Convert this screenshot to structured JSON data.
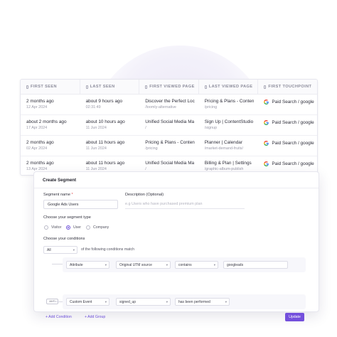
{
  "table": {
    "columns": [
      "FIRST SEEN",
      "LAST SEEN",
      "FIRST VIEWED PAGE",
      "LAST VIEWED PAGE",
      "FIRST TOUCHPOINT"
    ],
    "rows": [
      {
        "first_seen": "2 months ago",
        "first_seen_date": "12 Apr 2024",
        "last_seen": "about 9 hours ago",
        "last_seen_date": "02:31:49",
        "first_page_title": "Discover the Perfect Loc",
        "first_page_path": "/loomly-alternative",
        "last_page_title": "Pricing & Plans - Conten",
        "last_page_path": "/pricing",
        "touchpoint": "Paid Search / google"
      },
      {
        "first_seen": "about 2 months ago",
        "first_seen_date": "17 Apr 2024",
        "last_seen": "about 10 hours ago",
        "last_seen_date": "11 Jun 2024",
        "first_page_title": "Unified Social Media Ma",
        "first_page_path": "/",
        "last_page_title": "Sign Up | ContentStudio",
        "last_page_path": "/signup",
        "touchpoint": "Paid Search / google"
      },
      {
        "first_seen": "2 months ago",
        "first_seen_date": "02 Apr 2024",
        "last_seen": "about 11 hours ago",
        "last_seen_date": "11 Jun 2024",
        "first_page_title": "Pricing & Plans - Conten",
        "first_page_path": "/pricing",
        "last_page_title": "Planner | Calendar",
        "last_page_path": "/market-demand-fruits/",
        "touchpoint": "Paid Search / google"
      },
      {
        "first_seen": "2 months ago",
        "first_seen_date": "13 Apr 2024",
        "last_seen": "about 11 hours ago",
        "last_seen_date": "11 Jun 2024",
        "first_page_title": "Unified Social Media Ma",
        "first_page_path": "/",
        "last_page_title": "Billing & Plan | Settings",
        "last_page_path": "/graphic-album-publish",
        "touchpoint": "Paid Search / google"
      }
    ]
  },
  "segment": {
    "title": "Create Segment",
    "name_label": "Segment name",
    "required_mark": "*",
    "name_value": "Google Ads Users",
    "description_label": "Description (Optional)",
    "description_placeholder": "e.g Users who have purchased premium plan",
    "type_label": "Choose your segment type",
    "types": [
      "Visitor",
      "User",
      "Company"
    ],
    "selected_type": "User",
    "conditions_label": "Choose your conditions",
    "match_value": "All",
    "match_suffix": "of the following conditions match",
    "condition1": [
      "Attribute",
      "Original UTM source",
      "contains",
      "googleads"
    ],
    "and_label": "AND",
    "condition2": [
      "Custom Event",
      "signed_up",
      "has been performed"
    ],
    "add_condition": "+ Add Condition",
    "add_group": "+ Add Group",
    "update": "Update"
  },
  "colors": {
    "accent": "#7450dc",
    "border": "#e6e6ee"
  },
  "icons": {
    "touchpoint": "google-icon",
    "column": "column-icon"
  }
}
